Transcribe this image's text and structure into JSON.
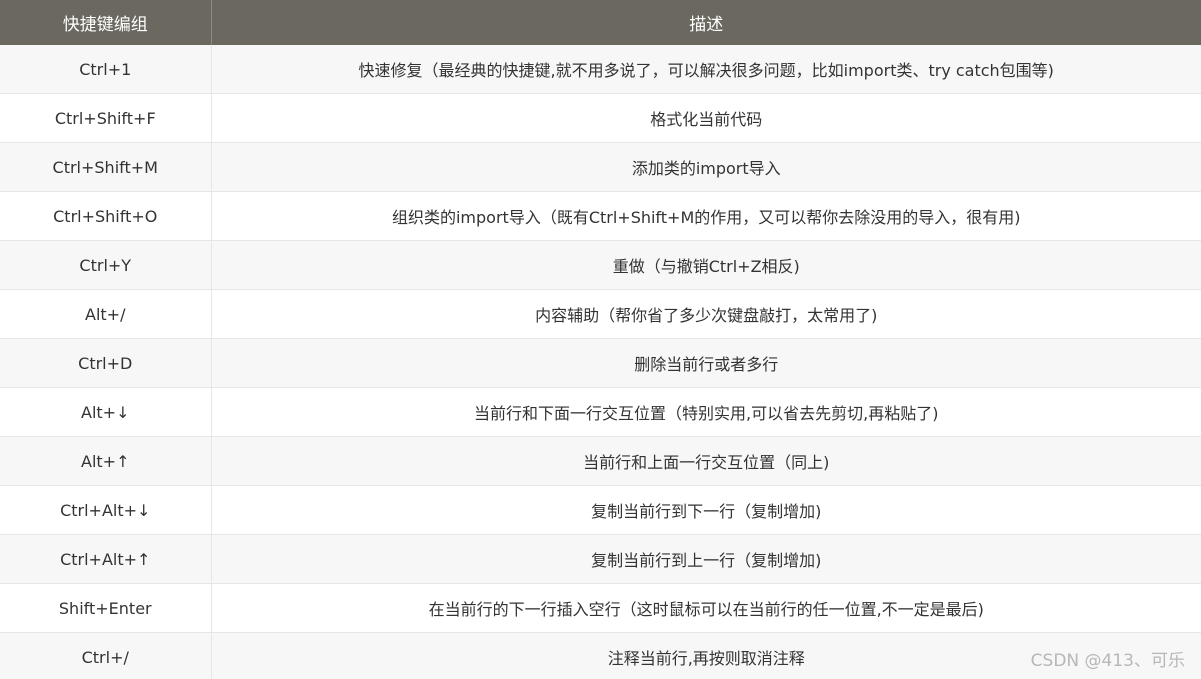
{
  "table": {
    "headers": [
      "快捷键编组",
      "描述"
    ],
    "rows": [
      {
        "key": "Ctrl+1",
        "desc": "快速修复（最经典的快捷键,就不用多说了，可以解决很多问题，比如import类、try catch包围等)"
      },
      {
        "key": "Ctrl+Shift+F",
        "desc": "格式化当前代码"
      },
      {
        "key": "Ctrl+Shift+M",
        "desc": "添加类的import导入"
      },
      {
        "key": "Ctrl+Shift+O",
        "desc": "组织类的import导入（既有Ctrl+Shift+M的作用，又可以帮你去除没用的导入，很有用)"
      },
      {
        "key": "Ctrl+Y",
        "desc": "重做（与撤销Ctrl+Z相反)"
      },
      {
        "key": "Alt+/",
        "desc": "内容辅助（帮你省了多少次键盘敲打，太常用了)"
      },
      {
        "key": "Ctrl+D",
        "desc": "删除当前行或者多行"
      },
      {
        "key": "Alt+↓",
        "desc": "当前行和下面一行交互位置（特别实用,可以省去先剪切,再粘贴了)"
      },
      {
        "key": "Alt+↑",
        "desc": "当前行和上面一行交互位置（同上)"
      },
      {
        "key": "Ctrl+Alt+↓",
        "desc": "复制当前行到下一行（复制增加)"
      },
      {
        "key": "Ctrl+Alt+↑",
        "desc": "复制当前行到上一行（复制增加)"
      },
      {
        "key": "Shift+Enter",
        "desc": "在当前行的下一行插入空行（这时鼠标可以在当前行的任一位置,不一定是最后)"
      },
      {
        "key": "Ctrl+/",
        "desc": "注释当前行,再按则取消注释"
      }
    ]
  },
  "watermark": "CSDN @413、可乐"
}
